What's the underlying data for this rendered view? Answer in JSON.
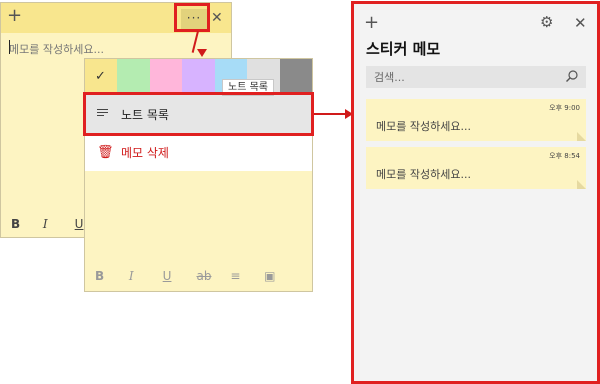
{
  "back_note": {
    "placeholder": "메모를 작성하세요...",
    "icons": {
      "add": "plus-icon",
      "menu": "more-icon",
      "close": "close-icon"
    },
    "format": [
      "B",
      "I",
      "U"
    ]
  },
  "front_note": {
    "swatches": [
      "#f8e68e",
      "#b4ecb1",
      "#ffb6da",
      "#d7b3ff",
      "#a7dcf7",
      "#e0e0e0",
      "#8a8a8a"
    ],
    "selected_swatch": 0,
    "tooltip": "노트 목록",
    "menu": {
      "notes_list": "노트 목록",
      "delete_note": "메모 삭제"
    },
    "format": [
      "B",
      "I",
      "U",
      "ab",
      "≡",
      "▣"
    ]
  },
  "panel": {
    "title": "스티커 메모",
    "search_placeholder": "검색...",
    "icons": {
      "add": "plus-icon",
      "settings": "gear-icon",
      "close": "close-icon",
      "search": "search-icon"
    },
    "notes": [
      {
        "time": "오후 9:00",
        "text": "메모를 작성하세요..."
      },
      {
        "time": "오후 8:54",
        "text": "메모를 작성하세요..."
      }
    ]
  },
  "colors": {
    "note_yellow": "#fdf4c2",
    "header_yellow": "#f8e68e",
    "highlight_red": "#e02020",
    "delete_red": "#d01a1a"
  }
}
